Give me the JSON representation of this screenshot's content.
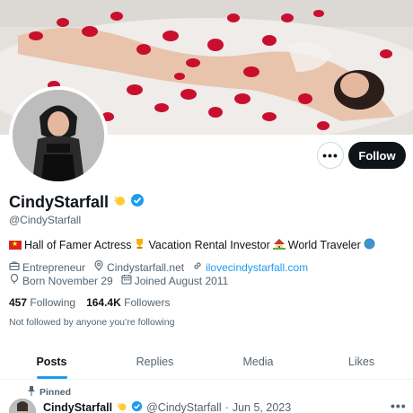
{
  "profile": {
    "display_name": "CindyStarfall",
    "handle": "@CindyStarfall",
    "bio_parts": [
      "Hall of Famer Actress",
      "Vacation Rental Investor",
      "World Traveler"
    ],
    "category": "Entrepreneur",
    "location": "Cindystarfall.net",
    "website": "ilovecindystarfall.com",
    "born": "Born November 29",
    "joined": "Joined August 2011",
    "following_count": "457",
    "following_label": "Following",
    "followers_count": "164.4K",
    "followers_label": "Followers",
    "not_followed_text": "Not followed by anyone you’re following"
  },
  "actions": {
    "more_label": "•••",
    "follow_label": "Follow"
  },
  "tabs": [
    {
      "label": "Posts",
      "active": true
    },
    {
      "label": "Replies",
      "active": false
    },
    {
      "label": "Media",
      "active": false
    },
    {
      "label": "Likes",
      "active": false
    }
  ],
  "pinned_tweet": {
    "pinned_label": "Pinned",
    "author_name": "CindyStarfall",
    "author_handle": "@CindyStarfall",
    "separator": "·",
    "date": "Jun 5, 2023",
    "more_label": "•••"
  },
  "colors": {
    "accent": "#1d9bf0",
    "text_primary": "#0f1419",
    "text_secondary": "#536471",
    "follow_button_bg": "#0f1419"
  },
  "icons": {
    "verified": "verified-badge-icon",
    "category": "briefcase-icon",
    "location": "location-pin-icon",
    "website": "link-icon",
    "born": "balloon-icon",
    "joined": "calendar-icon",
    "pinned": "pin-icon"
  }
}
